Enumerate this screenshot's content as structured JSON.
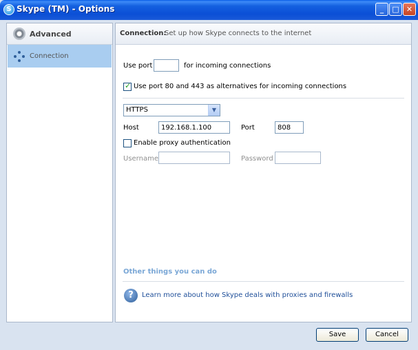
{
  "window": {
    "title": "Skype (TM) - Options",
    "app_icon": "skype-icon"
  },
  "sidebar": {
    "category": "Advanced",
    "items": [
      {
        "label": "Connection",
        "selected": true
      }
    ]
  },
  "header": {
    "title": "Connection:",
    "description": "Set up how Skype connects to the internet"
  },
  "port": {
    "label_before": "Use port",
    "value": "",
    "label_after": "for incoming connections"
  },
  "alt_ports": {
    "label": "Use port 80 and 443 as alternatives for incoming connections",
    "checked": true
  },
  "proxy": {
    "type": "HTTPS",
    "host_label": "Host",
    "host_value": "192.168.1.100",
    "port_label": "Port",
    "port_value": "808",
    "auth_label": "Enable proxy authentication",
    "auth_checked": false,
    "username_label": "Username",
    "username_value": "",
    "password_label": "Password",
    "password_value": ""
  },
  "other": {
    "heading": "Other things you can do",
    "link": "Learn more about how Skype deals with proxies and firewalls"
  },
  "buttons": {
    "save": "Save",
    "cancel": "Cancel"
  },
  "colors": {
    "titlebar": "#0b4fd6",
    "selection": "#a9cdf0",
    "link": "#1f4f99",
    "section_heading": "#7aa7d6",
    "check": "#21a121"
  }
}
